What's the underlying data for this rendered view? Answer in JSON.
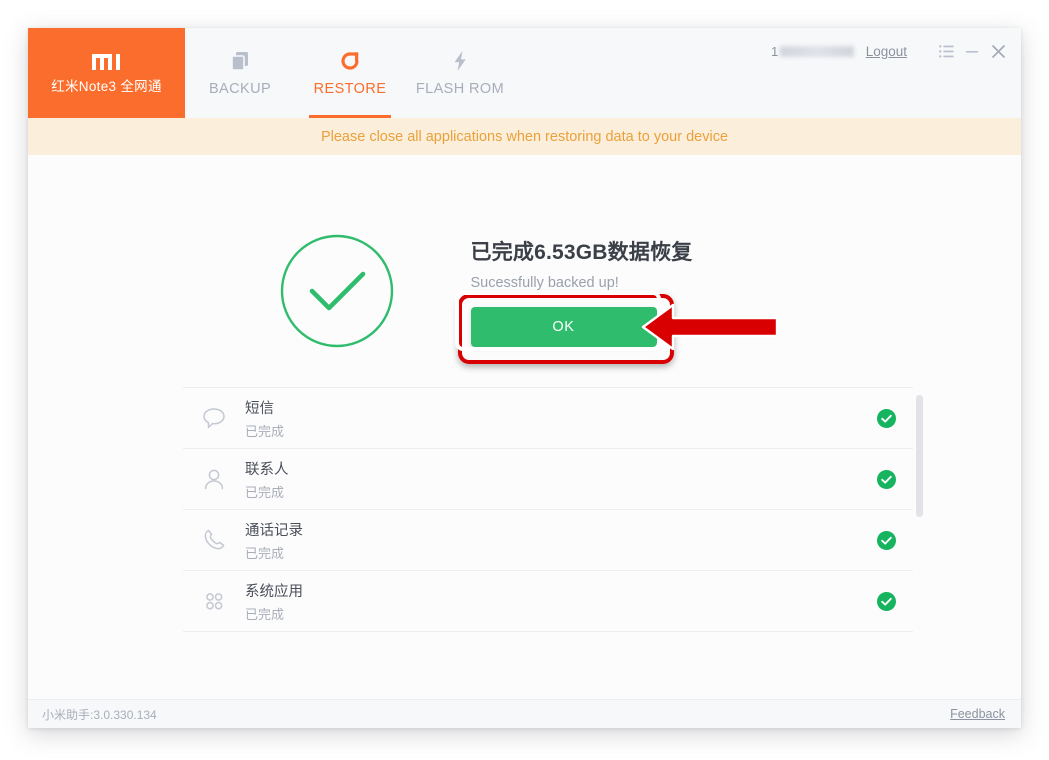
{
  "window": {
    "brand": {
      "logo_icon": "mi-logo",
      "device_name": "红米Note3 全网通"
    },
    "tabs": [
      {
        "label": "BACKUP",
        "icon": "copy-icon",
        "active": false
      },
      {
        "label": "RESTORE",
        "icon": "restore-icon",
        "active": true
      },
      {
        "label": "FLASH ROM",
        "icon": "lightning-icon",
        "active": false
      }
    ],
    "account": {
      "user_id_prefix": "1",
      "user_id_redacted": true,
      "logout_label": "Logout"
    },
    "window_controls": [
      {
        "name": "menu-icon",
        "glyph": "list"
      },
      {
        "name": "minimize-icon",
        "glyph": "minus"
      },
      {
        "name": "close-icon",
        "glyph": "cross"
      }
    ]
  },
  "banner": {
    "text": "Please close all applications when restoring data to your device"
  },
  "success": {
    "check_icon": "check-circle-icon",
    "title": "已完成6.53GB数据恢复",
    "subtitle": "Sucessfully backed up!",
    "ok_label": "OK",
    "highlight_color": "#d80000",
    "button_color": "#2fbd6d"
  },
  "list": {
    "items": [
      {
        "icon": "message-icon",
        "title": "短信",
        "status": "已完成",
        "done": true
      },
      {
        "icon": "person-icon",
        "title": "联系人",
        "status": "已完成",
        "done": true
      },
      {
        "icon": "phone-icon",
        "title": "通话记录",
        "status": "已完成",
        "done": true
      },
      {
        "icon": "apps-icon",
        "title": "系统应用",
        "status": "已完成",
        "done": true
      }
    ]
  },
  "footer": {
    "version": "小米助手:3.0.330.134",
    "feedback_label": "Feedback"
  },
  "colors": {
    "brand_orange": "#fb6d2c",
    "banner_bg": "#fbeeda",
    "banner_text": "#eaa13c",
    "success_green": "#2fbd6d",
    "annotation_red": "#d80000"
  }
}
